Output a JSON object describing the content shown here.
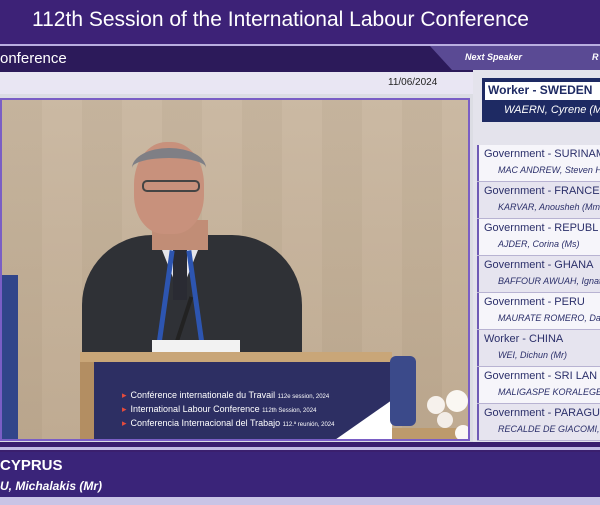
{
  "header": {
    "title": "112th Session of the International Labour Conference"
  },
  "subheader": {
    "title": "onference",
    "date": "11/06/2024"
  },
  "next_speaker": {
    "label": "Next Speaker",
    "right_label": "R"
  },
  "podium": {
    "line1": "Conférence internationale du Travail",
    "line1_sup": "112e session, 2024",
    "line2": "International Labour Conference",
    "line2_sup": "112th Session, 2024",
    "line3": "Conferencia Internacional del Trabajo",
    "line3_sup": "112.ª reunión, 2024"
  },
  "current_speaker": {
    "group": "Worker - SWEDEN",
    "name": "WAERN, Cyrene (M"
  },
  "queue": [
    {
      "group": "Government - SURINAM",
      "name": "MAC ANDREW, Steven H"
    },
    {
      "group": "Government - FRANCE",
      "name": "KARVAR, Anousheh (Mm"
    },
    {
      "group": "Government - REPUBL",
      "name": "AJDER, Corina (Ms)"
    },
    {
      "group": "Government - GHANA",
      "name": "BAFFOUR AWUAH, Ignat"
    },
    {
      "group": "Government - PERU",
      "name": "MAURATE ROMERO, Da"
    },
    {
      "group": "Worker - CHINA",
      "name": "WEI, Dichun (Mr)"
    },
    {
      "group": "Government - SRI LAN",
      "name": "MALIGASPE KORALEGE"
    },
    {
      "group": "Government - PARAGU",
      "name": "RECALDE DE GIACOMI,"
    }
  ],
  "lower_third": {
    "country": "CYPRUS",
    "name": "U, Michalakis (Mr)"
  },
  "colors": {
    "header": "#3d2277",
    "accent": "#7a5ec5",
    "panel_text": "#2b2f6a",
    "card_dark": "#1e2a63"
  }
}
